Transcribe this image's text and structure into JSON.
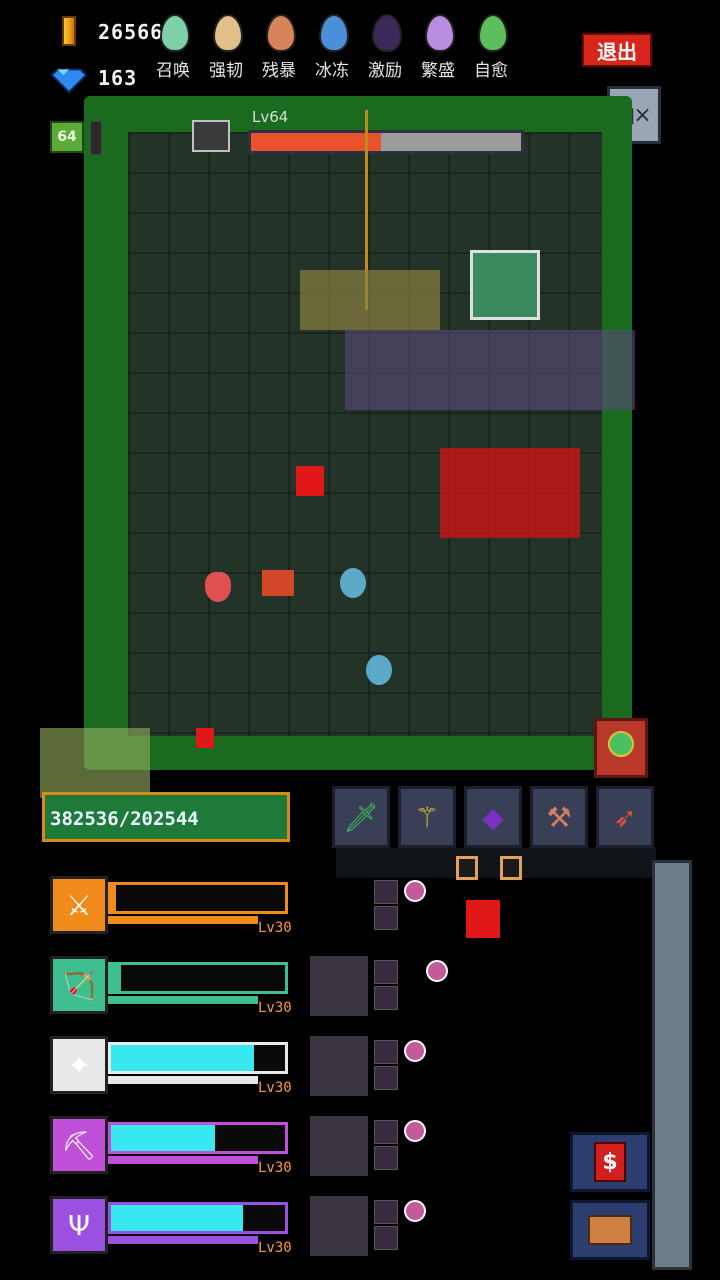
{
  "hud": {
    "gold": "26566",
    "gems": "163",
    "exit_label": "退出",
    "player_level": "64"
  },
  "eggs": [
    {
      "label": "召唤",
      "color": "#7fcfa8"
    },
    {
      "label": "强韧",
      "color": "#e3c08a"
    },
    {
      "label": "残暴",
      "color": "#d9835a"
    },
    {
      "label": "冰冻",
      "color": "#4a8fd8"
    },
    {
      "label": "激励",
      "color": "#3a2a5a"
    },
    {
      "label": "繁盛",
      "color": "#b88fe0"
    },
    {
      "label": "自愈",
      "color": "#5cbf5c"
    }
  ],
  "boss": {
    "level_label": "Lv64",
    "hp_fraction": 0.48
  },
  "exp": {
    "text": "382536/202544"
  },
  "skill_slots": [
    {
      "icon": "sword-icon",
      "glyph": "🗡",
      "color": "#3fbf5a"
    },
    {
      "icon": "staff-icon",
      "glyph": "⚚",
      "color": "#e0c040"
    },
    {
      "icon": "crystal-icon",
      "glyph": "◆",
      "color": "#7a30c0"
    },
    {
      "icon": "bone-axe-icon",
      "glyph": "⚒",
      "color": "#d08060"
    },
    {
      "icon": "bow-icon",
      "glyph": "➶",
      "color": "#e05040"
    }
  ],
  "heroes": [
    {
      "name": "flame-knight",
      "portrait_color": "#f08a1a",
      "glyph": "⚔",
      "hp_fraction": 0.03,
      "bar_color": "#f08a1a",
      "level": "Lv30"
    },
    {
      "name": "forest-ranger",
      "portrait_color": "#3fbf8f",
      "glyph": "🏹",
      "hp_fraction": 0.06,
      "bar_color": "#3fbf8f",
      "level": "Lv30"
    },
    {
      "name": "ice-mage",
      "portrait_color": "#e8e8e8",
      "glyph": "✦",
      "hp_fraction": 0.82,
      "bar_color": "#38e8f0",
      "level": "Lv30"
    },
    {
      "name": "shadow-miner",
      "portrait_color": "#c050d8",
      "glyph": "⛏",
      "hp_fraction": 0.6,
      "bar_color": "#38e8f0",
      "level": "Lv30"
    },
    {
      "name": "void-trident",
      "portrait_color": "#9a50e0",
      "glyph": "Ψ",
      "hp_fraction": 0.76,
      "bar_color": "#38e8f0",
      "level": "Lv30"
    }
  ],
  "colors": {
    "accent_red": "#d9261c",
    "grass": "#1a6a20",
    "floor": "#243328"
  }
}
